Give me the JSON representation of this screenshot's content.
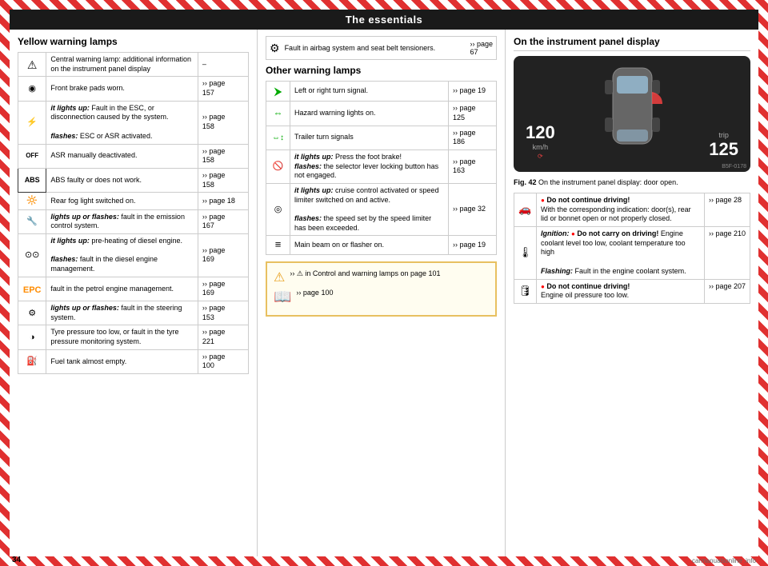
{
  "page": {
    "number": "34",
    "header": "The essentials"
  },
  "left_section": {
    "title": "Yellow warning lamps",
    "rows": [
      {
        "icon": "⚠",
        "text": "Central warning lamp: additional information on the instrument panel display",
        "page_ref": "–"
      },
      {
        "icon": "◎",
        "text": "Front brake pads worn.",
        "page_ref": "›› page 157"
      },
      {
        "icon": "⚙",
        "text_bold": "it lights up:",
        "text": " Fault in the ESC, or disconnection caused by the system.\n\nflashes: ESC or ASR activated.",
        "page_ref": "›› page 158"
      },
      {
        "icon": "OFF",
        "text": "ASR manually deactivated.",
        "page_ref": "›› page 158"
      },
      {
        "icon": "ABS",
        "text": "ABS faulty or does not work.",
        "page_ref": "›› page 158"
      },
      {
        "icon": "🔆",
        "text": "Rear fog light switched on.",
        "page_ref": "›› page 18"
      },
      {
        "icon": "🔧",
        "text_bold": "lights up or flashes:",
        "text": " fault in the emission control system.",
        "page_ref": "›› page 167"
      },
      {
        "icon": "⚙",
        "text_bold": "it lights up:",
        "text": " pre-heating of diesel engine.\n\nflashes: fault in the diesel engine management.",
        "page_ref": "›› page 169"
      },
      {
        "icon": "EPC",
        "text": "fault in the petrol engine management.",
        "page_ref": "›› page 169"
      },
      {
        "icon": "⚙",
        "text_bold": "lights up or flashes:",
        "text": " fault in the steering system.",
        "page_ref": "›› page 153"
      },
      {
        "icon": "🔘",
        "text": "Tyre pressure too low, or fault in the tyre pressure monitoring system.",
        "page_ref": "›› page 221"
      },
      {
        "icon": "⛽",
        "text": "Fuel tank almost empty.",
        "page_ref": "›› page 100"
      }
    ]
  },
  "middle_section": {
    "top_row": {
      "icon": "⚙",
      "text": "Fault in airbag system and seat belt tensioners.",
      "page_ref": "›› page 67"
    },
    "title": "Other warning lamps",
    "rows": [
      {
        "icon": "↑",
        "text": "Left or right turn signal.",
        "page_ref": "›› page 19"
      },
      {
        "icon": "↔",
        "text": "Hazard warning lights on.",
        "page_ref": "›› page 125"
      },
      {
        "icon": "↕",
        "text": "Trailer turn signals",
        "page_ref": "›› page 186"
      },
      {
        "icon": "🚫",
        "text_bold": "it lights up:",
        "text": " Press the foot brake!\nflashes: the selector lever locking button has not engaged.",
        "page_ref": "›› page 163"
      },
      {
        "icon": "⚙",
        "text_bold": "it lights up:",
        "text": " cruise control activated or speed limiter switched on and active.\n\nflashes: the speed set by the speed limiter has been exceeded.",
        "page_ref": "›› page 32"
      },
      {
        "icon": "≡",
        "text": "Main beam on or flasher on.",
        "page_ref": "›› page 19"
      }
    ],
    "notice": {
      "warning_text": "›› ⚠ in Control and warning lamps on page 101",
      "book_text": "›› page 100"
    }
  },
  "right_section": {
    "title": "On the instrument panel display",
    "fig_number": "Fig. 42",
    "fig_caption": "On the instrument panel display: door open.",
    "gauge": {
      "speed": "120",
      "unit": "km/h",
      "trip_label": "trip",
      "trip_value": "125"
    },
    "image_code": "B5F-0178",
    "rows": [
      {
        "icon": "🔧",
        "text_prefix_bold": "Do not continue driving!",
        "text": " With the corresponding indication: door(s), rear lid or bonnet open or not properly closed.",
        "page_ref": "›› page 28"
      },
      {
        "icon": "🌡",
        "text_italic_bold": "Ignition:",
        "text_prefix_bold": " Do not carry on driving!",
        "text": " Engine coolant level too low, coolant temperature too high\n\nFlashing: Fault in the engine coolant system.",
        "page_ref": "›› page 210"
      },
      {
        "icon": "🛢",
        "text_prefix_bold": "Do not continue driving!",
        "text": " Engine oil pressure too low.",
        "page_ref": "›› page 207"
      }
    ]
  }
}
